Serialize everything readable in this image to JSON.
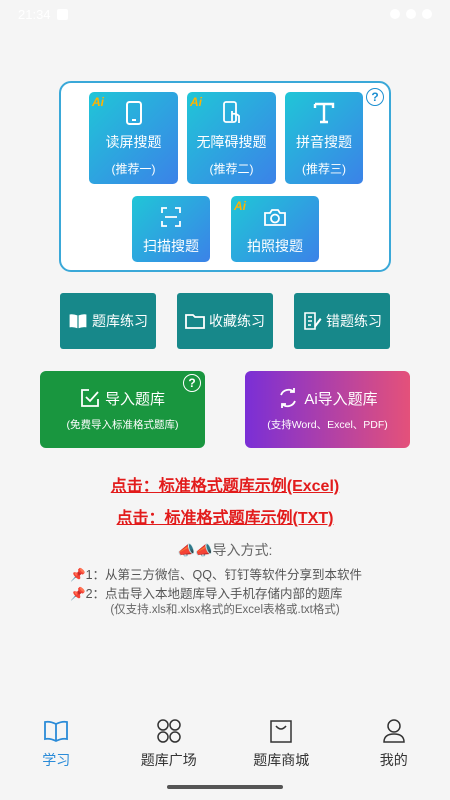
{
  "status_bar": {
    "time": "21:34"
  },
  "search": {
    "tiles": [
      {
        "label": "读屏搜题",
        "sub": "(推荐一)",
        "ai": "Ai",
        "icon": "phone-icon"
      },
      {
        "label": "无障碍搜题",
        "sub": "(推荐二)",
        "ai": "Ai",
        "icon": "touch-phone-icon"
      },
      {
        "label": "拼音搜题",
        "sub": "(推荐三)",
        "ai": "",
        "icon": "text-t-icon"
      },
      {
        "label": "扫描搜题",
        "sub": "",
        "ai": "",
        "icon": "scan-icon"
      },
      {
        "label": "拍照搜题",
        "sub": "",
        "ai": "Ai",
        "icon": "camera-icon"
      }
    ],
    "help": "?"
  },
  "practice": [
    {
      "label": "题库练习",
      "icon": "book-icon"
    },
    {
      "label": "收藏练习",
      "icon": "folder-icon"
    },
    {
      "label": "错题练习",
      "icon": "edit-note-icon"
    }
  ],
  "import": {
    "local": {
      "label": "导入题库",
      "sub": "(免费导入标准格式题库)",
      "help": "?"
    },
    "ai": {
      "label": "Ai导入题库",
      "sub": "(支持Word、Excel、PDF)"
    }
  },
  "links": {
    "excel": "点击：标准格式题库示例(Excel)",
    "txt": "点击：标准格式题库示例(TXT)"
  },
  "how": {
    "title": "📣📣导入方式:",
    "line1": "1：从第三方微信、QQ、钉钉等软件分享到本软件",
    "line2": "2：点击导入本地题库导入手机存储内部的题库",
    "note": "(仅支持.xls和.xlsx格式的Excel表格或.txt格式)"
  },
  "tabs": [
    {
      "label": "学习",
      "icon": "book-open-icon",
      "active": true
    },
    {
      "label": "题库广场",
      "icon": "grid-circles-icon",
      "active": false
    },
    {
      "label": "题库商城",
      "icon": "shopping-bag-icon",
      "active": false
    },
    {
      "label": "我的",
      "icon": "user-icon",
      "active": false
    }
  ],
  "colors": {
    "accent": "#2a8bd8",
    "teal": "#17888a",
    "green": "#19963f",
    "link_red": "#e21b1b"
  }
}
